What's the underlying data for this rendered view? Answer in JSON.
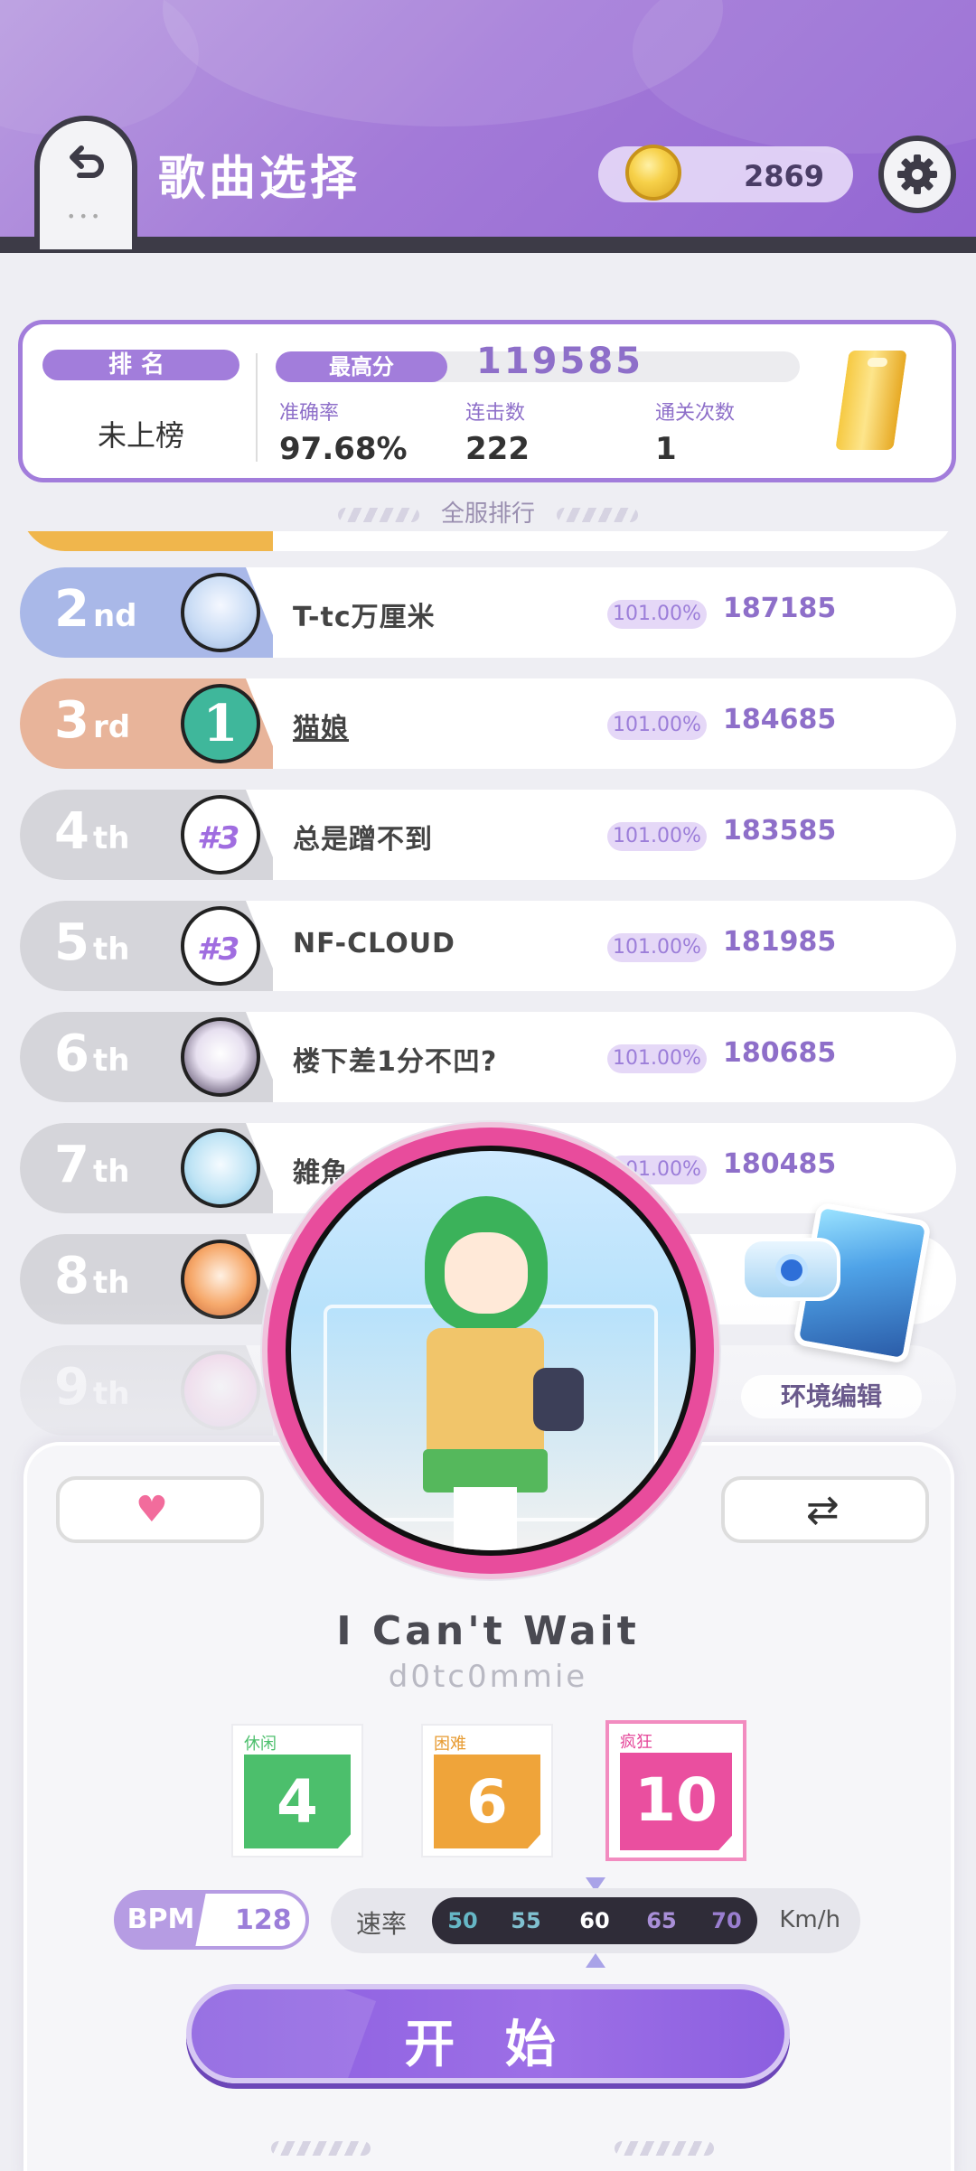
{
  "header": {
    "title": "歌曲选择",
    "coins": "2869"
  },
  "best": {
    "rank_label": "排名",
    "rank_value": "未上榜",
    "best_label": "最高分",
    "best_value": "119585",
    "accuracy_label": "准确率",
    "accuracy_value": "97.68%",
    "combo_label": "连击数",
    "combo_value": "222",
    "clears_label": "通关次数",
    "clears_value": "1"
  },
  "global_rank_label": "全服排行",
  "leaderboard": [
    {
      "rank": "2",
      "suffix": "nd",
      "name": "T-tc万厘米",
      "pct": "101.00%",
      "score": "187185"
    },
    {
      "rank": "3",
      "suffix": "rd",
      "name": "猫娘",
      "pct": "101.00%",
      "score": "184685"
    },
    {
      "rank": "4",
      "suffix": "th",
      "name": "总是蹭不到",
      "pct": "101.00%",
      "score": "183585"
    },
    {
      "rank": "5",
      "suffix": "th",
      "name": "NF-CLOUD",
      "pct": "101.00%",
      "score": "181985"
    },
    {
      "rank": "6",
      "suffix": "th",
      "name": "楼下差1分不凹?",
      "pct": "101.00%",
      "score": "180685"
    },
    {
      "rank": "7",
      "suffix": "th",
      "name": "雑魚",
      "pct": "101.00%",
      "score": "180485"
    },
    {
      "rank": "8",
      "suffix": "th",
      "name": "",
      "pct": "",
      "score": ""
    },
    {
      "rank": "9",
      "suffix": "th",
      "name": "",
      "pct": "",
      "score": ""
    }
  ],
  "environment_label": "环境编辑",
  "song": {
    "title": "I Can't Wait",
    "artist": "d0tc0mmie"
  },
  "difficulties": [
    {
      "label": "休闲",
      "level": "4",
      "color": "#4cbf6c"
    },
    {
      "label": "困难",
      "level": "6",
      "color": "#efa43a"
    },
    {
      "label": "疯狂",
      "level": "10",
      "color": "#ea4f9f"
    }
  ],
  "bpm": {
    "label": "BPM",
    "value": "128"
  },
  "speed": {
    "label": "速率",
    "unit": "Km/h",
    "options": [
      "50",
      "55",
      "60",
      "65",
      "70"
    ],
    "selected": "60"
  },
  "start_label": "开 始",
  "icons": {
    "back": "back-arrow-icon",
    "coin": "coin-icon",
    "settings": "gear-icon",
    "favorite": "heart-icon",
    "shuffle": "shuffle-icon",
    "trophy": "trophy-card-icon"
  },
  "colors": {
    "accent": "#a27ddb",
    "favorite": "#f26c9c",
    "cover_ring": "#e84c9c"
  }
}
